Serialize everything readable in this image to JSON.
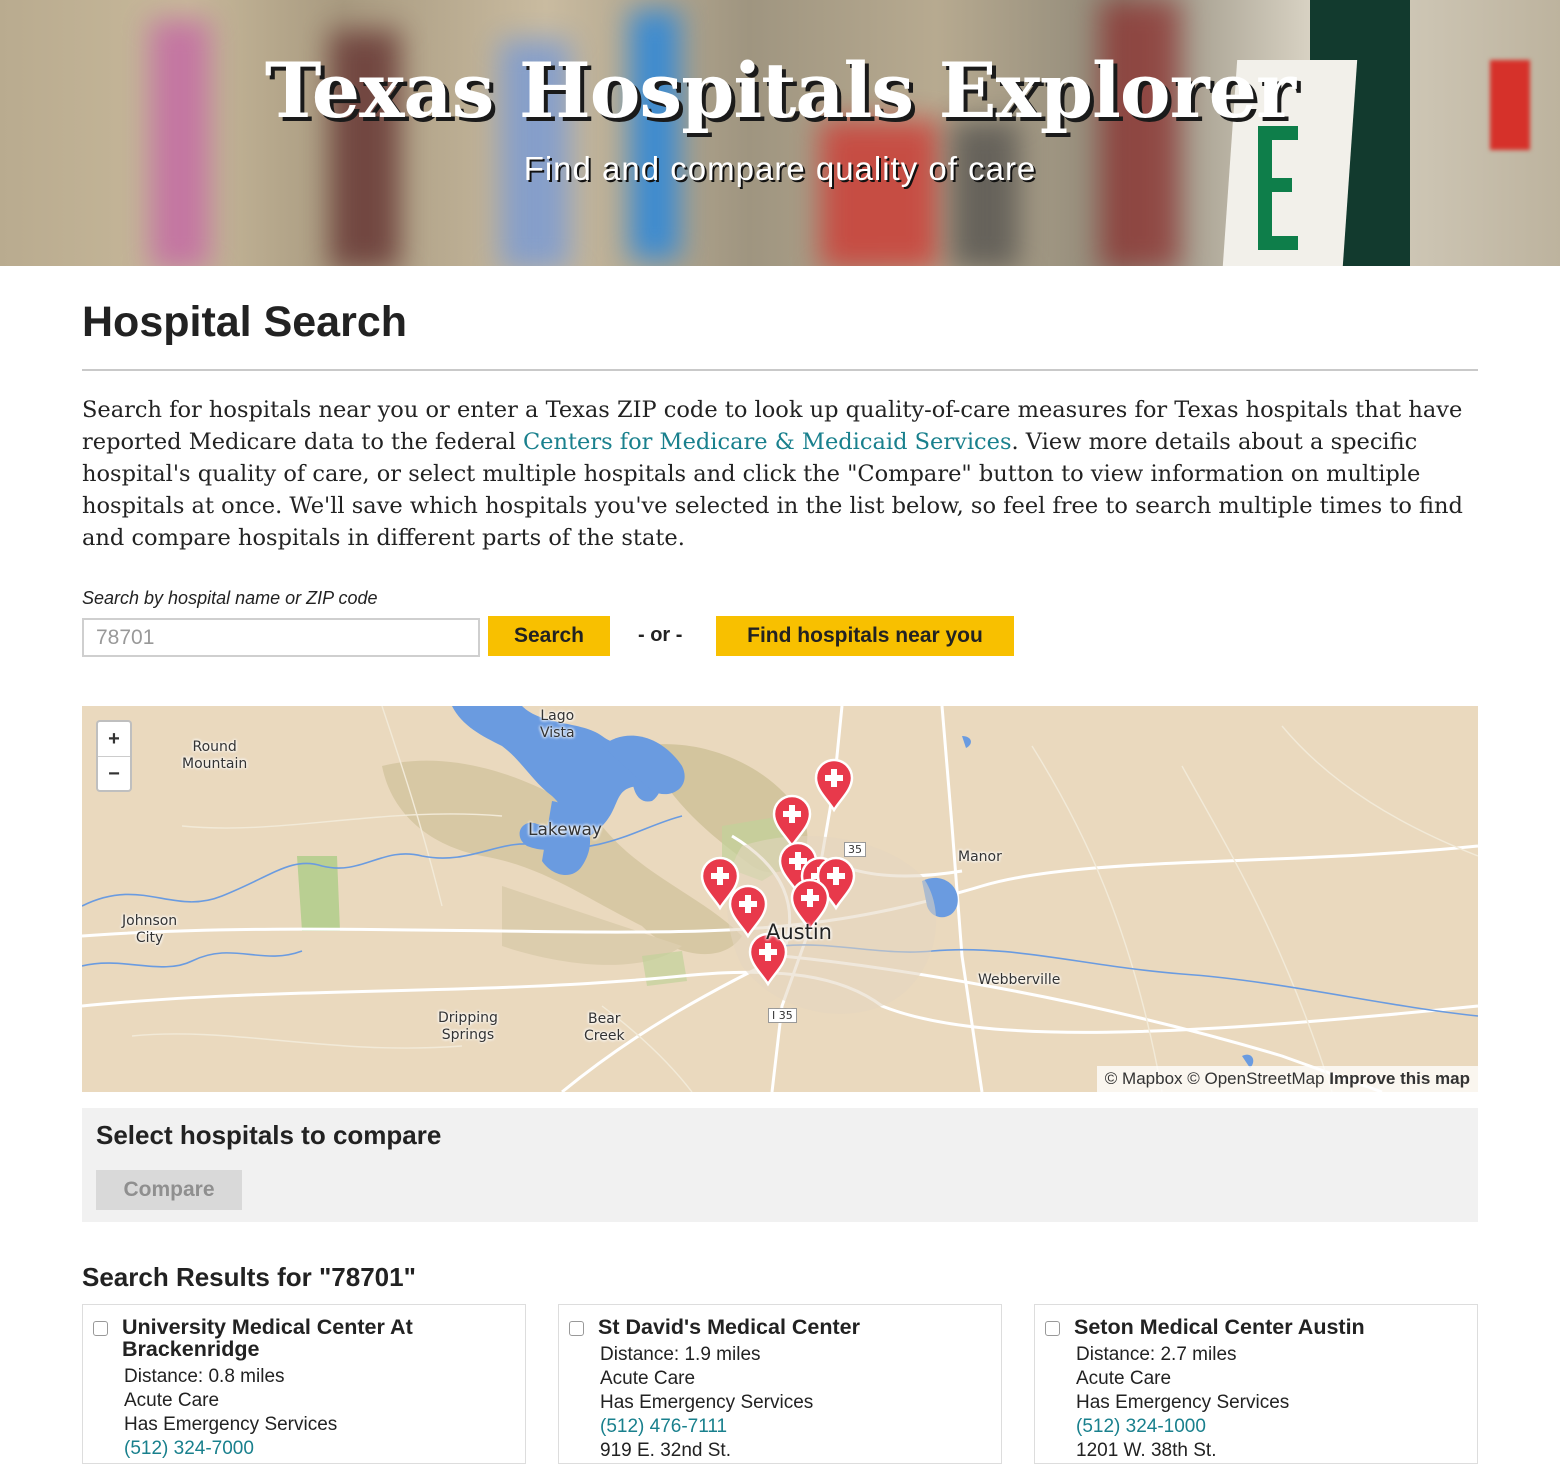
{
  "header": {
    "title": "Texas Hospitals Explorer",
    "subtitle": "Find and compare quality of care"
  },
  "page": {
    "title": "Hospital Search",
    "intro_before_link": "Search for hospitals near you or enter a Texas ZIP code to look up quality-of-care measures for Texas hospitals that have reported Medicare data to the federal ",
    "intro_link": "Centers for Medicare & Medicaid Services",
    "intro_after_link": ". View more details about a specific hospital's quality of care, or select multiple hospitals and click the \"Compare\" button to view information on multiple hospitals at once. We'll save which hospitals you've selected in the list below, so feel free to search multiple times to find and compare hospitals in different parts of the state."
  },
  "search": {
    "label": "Search by hospital name or ZIP code",
    "value": "78701",
    "search_button": "Search",
    "or_text": "- or -",
    "near_button": "Find hospitals near you"
  },
  "map": {
    "zoom_in": "+",
    "zoom_out": "−",
    "places": {
      "lago_vista": "Lago\nVista",
      "round_mountain": "Round\nMountain",
      "lakeway": "Lakeway",
      "manor": "Manor",
      "johnson_city": "Johnson\nCity",
      "austin": "Austin",
      "webberville": "Webberville",
      "dripping_springs": "Dripping\nSprings",
      "bear_creek": "Bear\nCreek",
      "i35_north": "35",
      "i35_south": "I 35"
    },
    "attribution_text": "© Mapbox © OpenStreetMap ",
    "improve_link": "Improve this map",
    "marker_count": 9,
    "colors": {
      "land": "#ead9be",
      "water": "#6a9be0",
      "park": "#b9cf92",
      "marker": "#e8394b"
    }
  },
  "compare": {
    "title": "Select hospitals to compare",
    "button": "Compare"
  },
  "results": {
    "title": "Search Results for \"78701\"",
    "hospitals": [
      {
        "name": "University Medical Center At Brackenridge",
        "distance": "Distance: 0.8 miles",
        "type": "Acute Care",
        "emergency": "Has Emergency Services",
        "phone": "(512) 324-7000"
      },
      {
        "name": "St David's Medical Center",
        "distance": "Distance: 1.9 miles",
        "type": "Acute Care",
        "emergency": "Has Emergency Services",
        "phone": "(512) 476-7111",
        "address": "919 E. 32nd St."
      },
      {
        "name": "Seton Medical Center Austin",
        "distance": "Distance: 2.7 miles",
        "type": "Acute Care",
        "emergency": "Has Emergency Services",
        "phone": "(512) 324-1000",
        "address": "1201 W. 38th St."
      }
    ]
  }
}
